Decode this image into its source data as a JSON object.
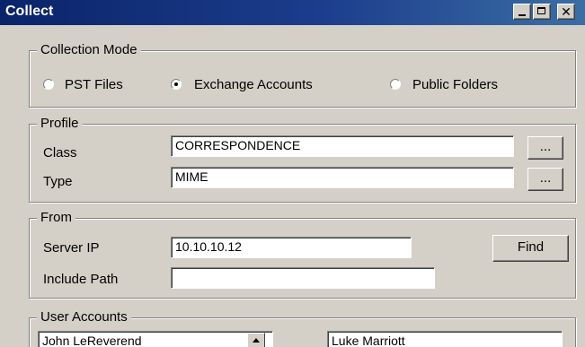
{
  "window": {
    "title": "Collect"
  },
  "collection_mode": {
    "legend": "Collection Mode",
    "options": [
      {
        "label": "PST Files",
        "checked": false
      },
      {
        "label": "Exchange Accounts",
        "checked": true
      },
      {
        "label": "Public Folders",
        "checked": false
      }
    ]
  },
  "profile": {
    "legend": "Profile",
    "class_label": "Class",
    "class_value": "CORRESPONDENCE",
    "type_label": "Type",
    "type_value": "MIME",
    "browse_label": "..."
  },
  "from": {
    "legend": "From",
    "server_ip_label": "Server IP",
    "server_ip_value": "10.10.10.12",
    "include_path_label": "Include Path",
    "include_path_value": "",
    "find_label": "Find"
  },
  "user_accounts": {
    "legend": "User Accounts",
    "left_list_first": "John LeReverend",
    "right_list_first": "Luke Marriott"
  }
}
